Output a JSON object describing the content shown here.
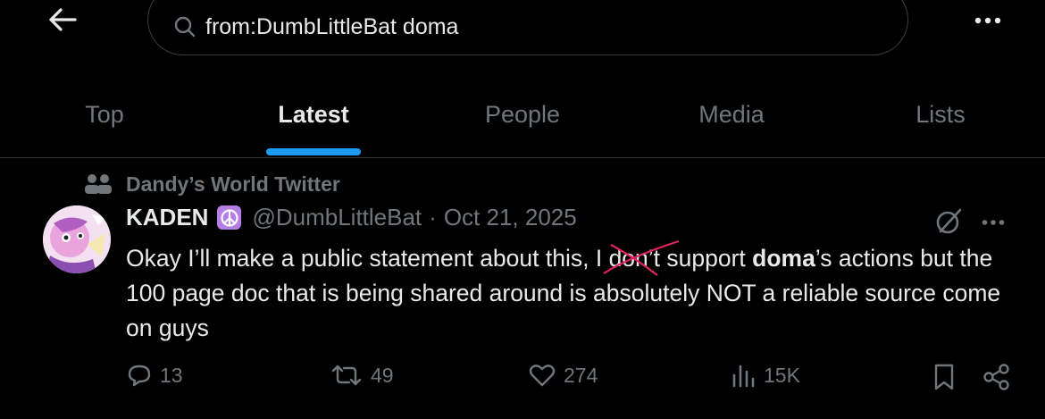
{
  "header": {
    "search_query": "from:DumbLittleBat doma"
  },
  "tabs": [
    {
      "label": "Top",
      "active": false
    },
    {
      "label": "Latest",
      "active": true
    },
    {
      "label": "People",
      "active": false
    },
    {
      "label": "Media",
      "active": false
    },
    {
      "label": "Lists",
      "active": false
    }
  ],
  "post": {
    "social_context": "Dandy’s World Twitter",
    "author_name": "KADEN",
    "badge_icon": "peace-sign-icon",
    "handle": "@DumbLittleBat",
    "separator": "·",
    "date": "Oct 21, 2025",
    "text_part1": "Okay I’ll make a public statement about this, I ",
    "text_struck": "don’t",
    "text_part2": " support ",
    "text_bold": "doma",
    "text_part3": "’s actions but the 100 page doc that is being shared around is absolutely NOT a reliable source come on guys",
    "replies": "13",
    "reposts": "49",
    "likes": "274",
    "views": "15K"
  },
  "colors": {
    "background": "#000000",
    "text": "#e7e9ea",
    "muted": "#71767b",
    "accent": "#1d9bf0",
    "strike": "#e0245e",
    "badge": "#b57de6"
  }
}
